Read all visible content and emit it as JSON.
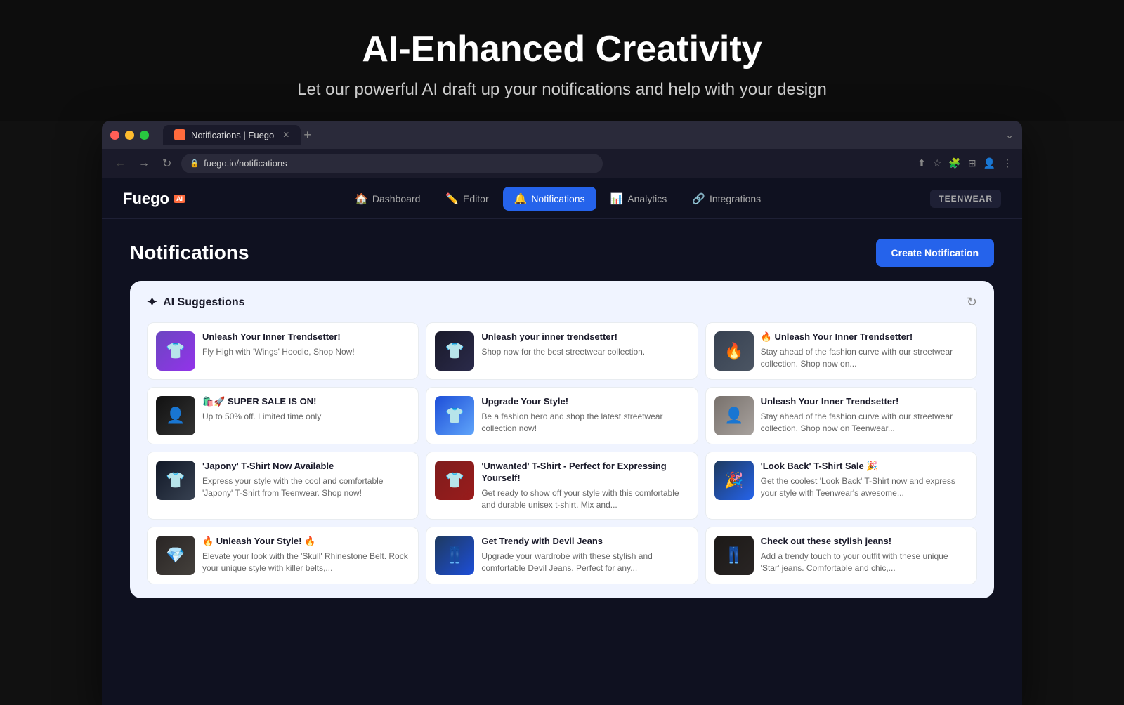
{
  "hero": {
    "title": "AI-Enhanced Creativity",
    "subtitle": "Let our powerful AI draft up your notifications and help with your design"
  },
  "browser": {
    "tab_title": "Notifications | Fuego",
    "url": "fuego.io/notifications"
  },
  "nav": {
    "logo": "Fuego",
    "logo_badge": "AI",
    "links": [
      {
        "id": "dashboard",
        "label": "Dashboard",
        "icon": "🏠",
        "active": false
      },
      {
        "id": "editor",
        "label": "Editor",
        "icon": "✏️",
        "active": false
      },
      {
        "id": "notifications",
        "label": "Notifications",
        "icon": "🔔",
        "active": true
      },
      {
        "id": "analytics",
        "label": "Analytics",
        "icon": "📊",
        "active": false
      },
      {
        "id": "integrations",
        "label": "Integrations",
        "icon": "🔗",
        "active": false
      }
    ],
    "user_badge": "TEENWEAR"
  },
  "page": {
    "title": "Notifications",
    "create_button": "Create Notification"
  },
  "ai_suggestions": {
    "title": "AI Suggestions",
    "sparkle": "✦",
    "cards": [
      {
        "id": 1,
        "img_class": "img-purple",
        "img_emoji": "👕",
        "title": "Unleash Your Inner Trendsetter!",
        "desc": "Fly High with 'Wings' Hoodie, Shop Now!"
      },
      {
        "id": 2,
        "img_class": "img-dark",
        "img_emoji": "👕",
        "title": "Unleash your inner trendsetter!",
        "desc": "Shop now for the best streetwear collection."
      },
      {
        "id": 3,
        "img_class": "img-gray",
        "img_emoji": "🔥",
        "title": "🔥 Unleash Your Inner Trendsetter!",
        "desc": "Stay ahead of the fashion curve with our streetwear collection. Shop now on..."
      },
      {
        "id": 4,
        "img_class": "img-black",
        "img_emoji": "👤",
        "title": "🛍️🚀 SUPER SALE IS ON!",
        "desc": "Up to 50% off. Limited time only"
      },
      {
        "id": 5,
        "img_class": "img-blue",
        "img_emoji": "👕",
        "title": "Upgrade Your Style!",
        "desc": "Be a fashion hero and shop the latest streetwear collection now!"
      },
      {
        "id": 6,
        "img_class": "img-stairs",
        "img_emoji": "👤",
        "title": "Unleash Your Inner Trendsetter!",
        "desc": "Stay ahead of the fashion curve with our streetwear collection. Shop now on Teenwear..."
      },
      {
        "id": 7,
        "img_class": "img-tshirt-black",
        "img_emoji": "👕",
        "title": "'Japony' T-Shirt Now Available",
        "desc": "Express your style with the cool and comfortable 'Japony' T-Shirt from Teenwear. Shop now!"
      },
      {
        "id": 8,
        "img_class": "img-tshirt-red",
        "img_emoji": "👕",
        "title": "'Unwanted' T-Shirt - Perfect for Expressing Yourself!",
        "desc": "Get ready to show off your style with this comfortable and durable unisex t-shirt. Mix and..."
      },
      {
        "id": 9,
        "img_class": "img-tshirt-blue",
        "img_emoji": "🎉",
        "title": "'Look Back' T-Shirt Sale 🎉",
        "desc": "Get the coolest 'Look Back' T-Shirt now and express your style with Teenwear's awesome..."
      },
      {
        "id": 10,
        "img_class": "img-belt",
        "img_emoji": "💎",
        "title": "🔥 Unleash Your Style! 🔥",
        "desc": "Elevate your look with the 'Skull' Rhinestone Belt. Rock your unique style with killer belts,..."
      },
      {
        "id": 11,
        "img_class": "img-jeans",
        "img_emoji": "👖",
        "title": "Get Trendy with Devil Jeans",
        "desc": "Upgrade your wardrobe with these stylish and comfortable Devil Jeans. Perfect for any..."
      },
      {
        "id": 12,
        "img_class": "img-jeans-dark",
        "img_emoji": "👖",
        "title": "Check out these stylish jeans!",
        "desc": "Add a trendy touch to your outfit with these unique 'Star' jeans. Comfortable and chic,..."
      }
    ]
  }
}
